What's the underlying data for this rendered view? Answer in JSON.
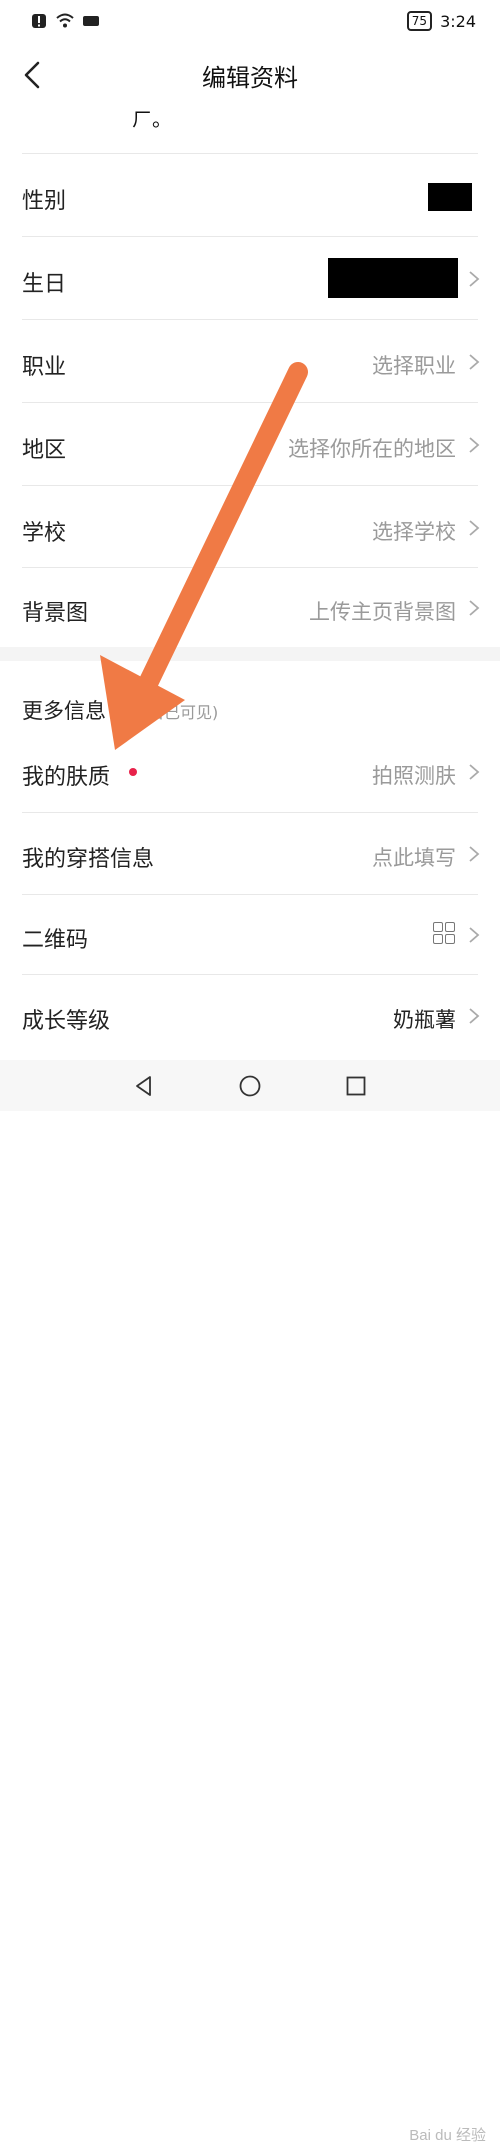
{
  "status_bar": {
    "time": "3:24",
    "battery": "75"
  },
  "header": {
    "title": "编辑资料"
  },
  "partial_text": "ㄏ。",
  "rows": [
    {
      "label": "性别",
      "value": ""
    },
    {
      "label": "生日",
      "value": ""
    },
    {
      "label": "职业",
      "value": "选择职业"
    },
    {
      "label": "地区",
      "value": "选择你所在的地区"
    },
    {
      "label": "学校",
      "value": "选择学校"
    },
    {
      "label": "背景图",
      "value": "上传主页背景图"
    }
  ],
  "more_section": {
    "title": "更多信息",
    "note": "自己可见)",
    "rows": [
      {
        "label": "我的肤质",
        "value": "拍照测肤"
      },
      {
        "label": "我的穿搭信息",
        "value": "点此填写"
      },
      {
        "label": "二维码",
        "value": ""
      },
      {
        "label": "成长等级",
        "value": "奶瓶薯"
      }
    ]
  },
  "colors": {
    "accent_arrow": "#f07a45",
    "red_dot": "#e8224a",
    "secondary_text": "#9a9a9a"
  },
  "icons": [
    "back-icon",
    "chevron-right-icon",
    "qr-grid-icon",
    "nav-back-icon",
    "nav-home-icon",
    "nav-recent-icon"
  ],
  "watermark": "Bai du 经验"
}
